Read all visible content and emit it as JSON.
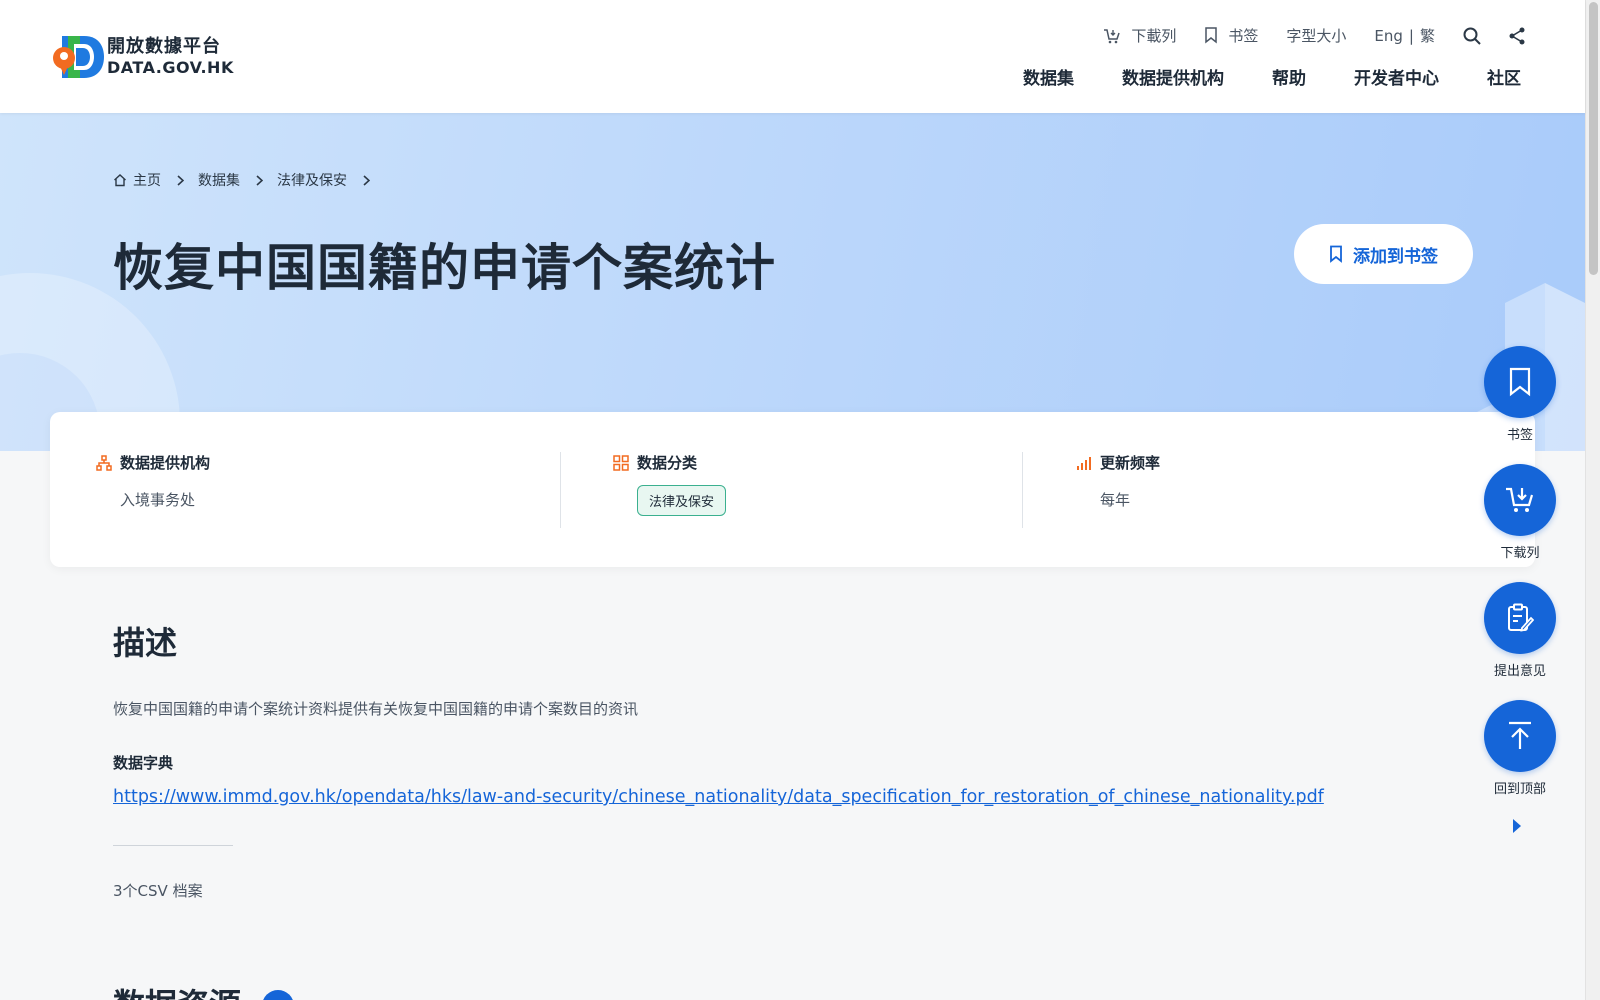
{
  "header": {
    "logo_cn": "開放數據平台",
    "logo_en": "DATA.GOV.HK",
    "util": {
      "download_list": "下載列",
      "bookmark": "书签",
      "font_size": "字型大小",
      "lang_en": "Eng",
      "lang_sep": "|",
      "lang_tc": "繁"
    },
    "nav": [
      "数据集",
      "数据提供机构",
      "帮助",
      "开发者中心",
      "社区"
    ]
  },
  "breadcrumb": [
    "主页",
    "数据集",
    "法律及保安"
  ],
  "page_title": "恢复中国国籍的申请个案统计",
  "bookmark_button": "添加到书签",
  "info": {
    "provider_label": "数据提供机构",
    "provider_value": "入境事务处",
    "category_label": "数据分类",
    "category_value": "法律及保安",
    "frequency_label": "更新频率",
    "frequency_value": "每年"
  },
  "content": {
    "desc_title": "描述",
    "description": "恢复中国国籍的申请个案统计资料提供有关恢复中国国籍的申请个案数目的资讯",
    "dict_label": "数据字典",
    "dict_link": "https://www.immd.gov.hk/opendata/hks/law-and-security/chinese_nationality/data_specification_for_restoration_of_chinese_nationality.pdf",
    "file_count": "3个CSV 档案",
    "resources_title": "数据资源"
  },
  "side": {
    "bookmark": "书签",
    "download_list": "下载列",
    "feedback": "提出意见",
    "back_to_top": "回到顶部"
  },
  "colors": {
    "primary": "#1565d8",
    "accent_orange": "#f26b21",
    "tag_green": "#3bb08f"
  }
}
